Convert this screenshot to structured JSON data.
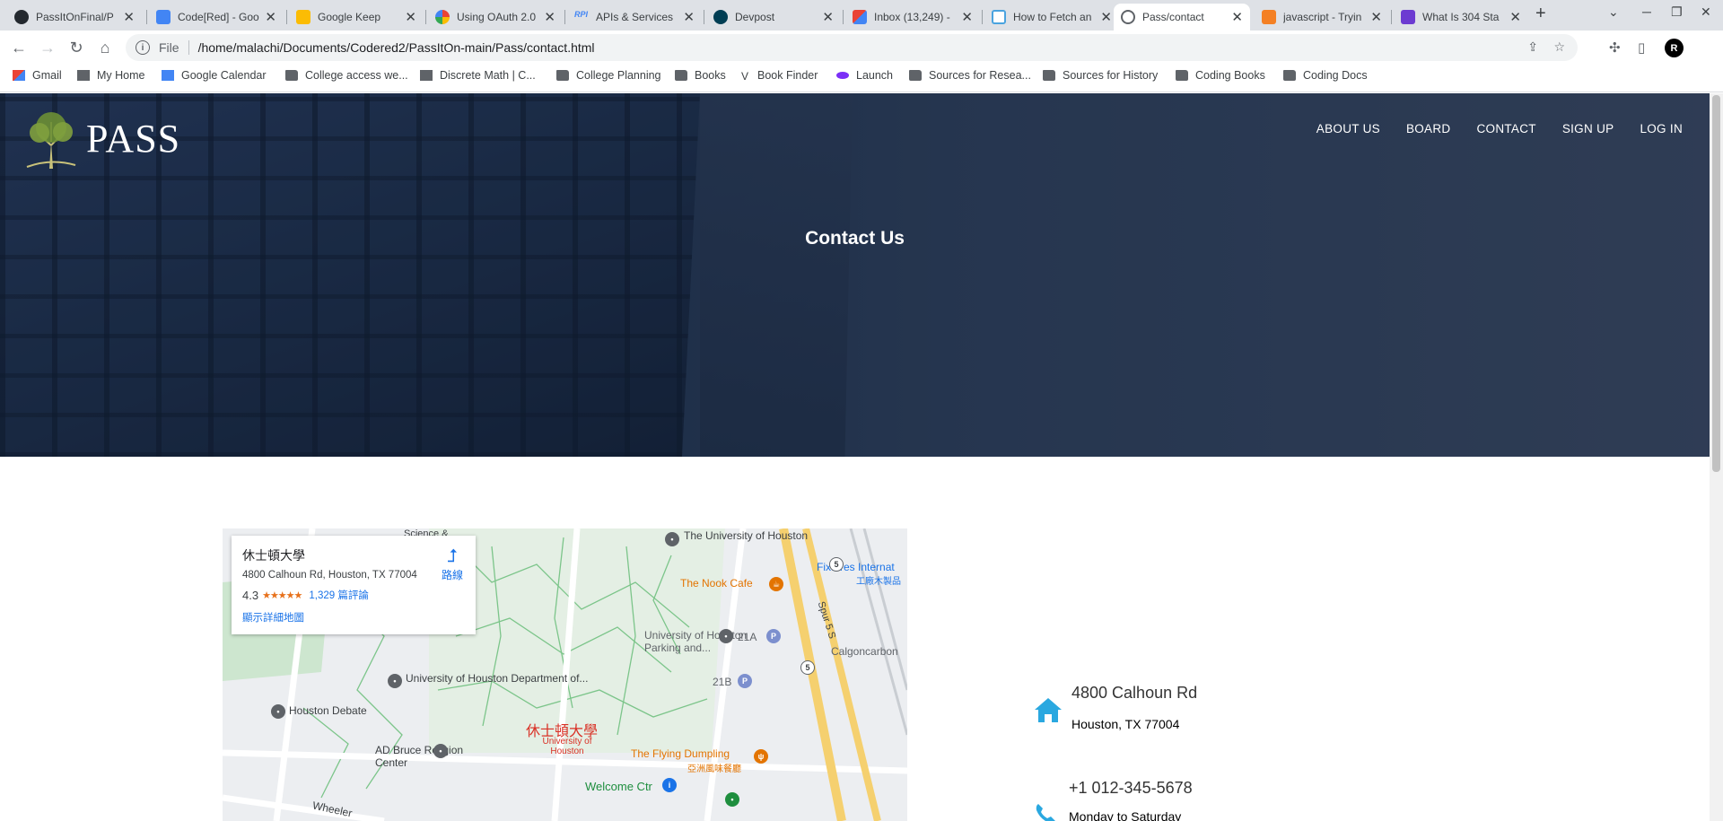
{
  "browser": {
    "tabs": [
      {
        "label": "PassItOnFinal/P",
        "icon": "github-icon",
        "color": "#24292f"
      },
      {
        "label": "Code[Red] - Goo",
        "icon": "google-docs-icon",
        "color": "#4285f4"
      },
      {
        "label": "Google Keep",
        "icon": "google-keep-icon",
        "color": "#fbbc04"
      },
      {
        "label": "Using OAuth 2.0",
        "icon": "google-cloud-icon",
        "color": "#ea4335"
      },
      {
        "label": "APIs & Services",
        "icon": "api-icon",
        "color": "#4285f4"
      },
      {
        "label": "Devpost",
        "icon": "devpost-icon",
        "color": "#003e54"
      },
      {
        "label": "Inbox (13,249) -",
        "icon": "gmail-icon",
        "color": "#ea4335"
      },
      {
        "label": "How to Fetch an",
        "icon": "page-icon",
        "color": "#4aa3df"
      },
      {
        "label": "Pass/contact",
        "icon": "globe-icon",
        "color": "#5f6368"
      },
      {
        "label": "javascript - Tryin",
        "icon": "stackoverflow-icon",
        "color": "#f48024"
      },
      {
        "label": "What Is 304 Sta",
        "icon": "site-icon",
        "color": "#6c3bd1"
      }
    ],
    "active_tab": 8,
    "url_scheme": "File",
    "url": "/home/malachi/Documents/Codered2/PassItOn-main/Pass/contact.html",
    "profile_initial": "R",
    "bookmarks": [
      {
        "label": "Gmail",
        "icon": "gmail-icon"
      },
      {
        "label": "My Home",
        "icon": "site-icon"
      },
      {
        "label": "Google Calendar",
        "icon": "google-calendar-icon"
      },
      {
        "label": "College access we...",
        "icon": "folder-icon"
      },
      {
        "label": "Discrete Math | C...",
        "icon": "site-icon"
      },
      {
        "label": "College Planning",
        "icon": "folder-icon"
      },
      {
        "label": "Books",
        "icon": "folder-icon"
      },
      {
        "label": "Book Finder",
        "icon": "site-icon"
      },
      {
        "label": "Launch",
        "icon": "launch-icon"
      },
      {
        "label": "Sources for Resea...",
        "icon": "folder-icon"
      },
      {
        "label": "Sources for History",
        "icon": "folder-icon"
      },
      {
        "label": "Coding Books",
        "icon": "folder-icon"
      },
      {
        "label": "Coding Docs",
        "icon": "folder-icon"
      }
    ]
  },
  "page": {
    "logo_text": "PASS",
    "nav": [
      "ABOUT US",
      "BOARD",
      "CONTACT",
      "SIGN UP",
      "LOG IN"
    ],
    "hero_title": "Contact Us",
    "map": {
      "place_name": "休士頓大學",
      "address": "4800 Calhoun Rd, Houston, TX 77004",
      "rating": "4.3",
      "stars": "★★★★★",
      "reviews": "1,329 篇評論",
      "directions": "路線",
      "larger_map": "顯示詳細地圖",
      "labels": {
        "univ_houston": "The University of Houston",
        "nook_cafe": "The Nook Cafe",
        "fixtures": "Fixtures Internat",
        "fixtures_cn": "工廠木製品",
        "spur": "Spur 5 S",
        "univ_parking": "University of Houston Parking and...",
        "calgon": "Calgoncarbon",
        "dept": "University of Houston Department of...",
        "debate": "Houston Debate",
        "center_label": "休士頓大學",
        "center_sub": "University of Houston",
        "ad_bruce": "AD Bruce Religion Center",
        "flying_dumpling": "The Flying Dumpling",
        "flying_dumpling_cn": "亞洲風味餐廳",
        "welcome": "Welcome Ctr",
        "wheeler": "Wheeler",
        "science": "Science &",
        "lot_21a": "21A",
        "lot_21b": "21B",
        "route_5a": "5",
        "route_5b": "5"
      }
    },
    "contact": {
      "address_line1": "4800 Calhoun Rd",
      "address_line2": "Houston, TX 77004",
      "phone": "+1 012-345-5678",
      "hours": "Monday to Saturday"
    },
    "accent_color": "#2aa8e0"
  }
}
